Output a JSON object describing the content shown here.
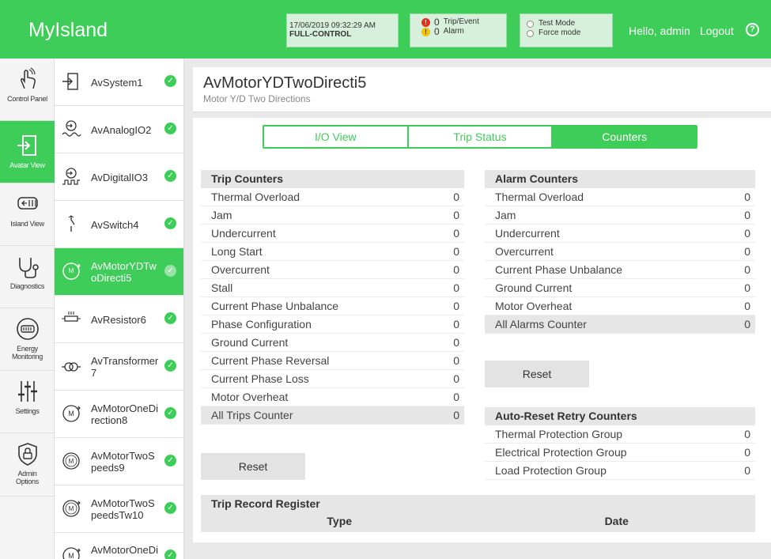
{
  "header": {
    "app_name": "MyIsland",
    "timestamp": "17/06/2019 09:32:29 AM",
    "control_mode": "FULL-CONTROL",
    "trip_count": "0",
    "trip_label": "Trip/Event",
    "alarm_count": "0",
    "alarm_label": "Alarm",
    "test_mode_label": "Test Mode",
    "force_mode_label": "Force mode",
    "greeting": "Hello, admin",
    "logout_label": "Logout",
    "help_glyph": "?",
    "accent_color": "#3dcd58"
  },
  "nav": {
    "control_panel": "Control Panel",
    "avatar_view": "Avatar View",
    "island_view": "Island View",
    "diagnostics": "Diagnostics",
    "energy_line1": "Energy",
    "energy_line2": "Monitoring",
    "settings": "Settings",
    "admin_line1": "Admin",
    "admin_line2": "Options"
  },
  "devices": [
    {
      "name": "AvSystem1",
      "icon": "system-icon"
    },
    {
      "name": "AvAnalogIO2",
      "icon": "analog-io-icon"
    },
    {
      "name": "AvDigitalIO3",
      "icon": "digital-io-icon"
    },
    {
      "name": "AvSwitch4",
      "icon": "switch-icon"
    },
    {
      "name": "AvMotorYDTwoDirecti5",
      "icon": "motor-icon"
    },
    {
      "name": "AvResistor6",
      "icon": "resistor-icon"
    },
    {
      "name": "AvTransformer7",
      "icon": "transformer-icon"
    },
    {
      "name": "AvMotorOneDirection8",
      "icon": "motor-icon"
    },
    {
      "name": "AvMotorTwoSpeeds9",
      "icon": "motor-icon"
    },
    {
      "name": "AvMotorTwoSpeedsTw10",
      "icon": "motor-icon"
    },
    {
      "name": "AvMotorOneDi",
      "icon": "motor-icon"
    }
  ],
  "device_labels": [
    "AvSystem1",
    "AvAnalogIO2",
    "AvDigitalIO3",
    "AvSwitch4",
    "AvMotorYDTw\noDirecti5",
    "AvResistor6",
    "AvTransformer\n7",
    "AvMotorOneDi\nrection8",
    "AvMotorTwoS\npeeds9",
    "AvMotorTwoS\npeedsTw10",
    "AvMotorOneDi"
  ],
  "main": {
    "device_title": "AvMotorYDTwoDirecti5",
    "device_subtitle": "Motor Y/D Two Directions",
    "tabs": [
      "I/O View",
      "Trip Status",
      "Counters"
    ],
    "active_tab": "Counters"
  },
  "trip_counters": {
    "title": "Trip Counters",
    "rows": [
      {
        "label": "Thermal Overload",
        "value": "0"
      },
      {
        "label": "Jam",
        "value": "0"
      },
      {
        "label": "Undercurrent",
        "value": "0"
      },
      {
        "label": "Long Start",
        "value": "0"
      },
      {
        "label": "Overcurrent",
        "value": "0"
      },
      {
        "label": "Stall",
        "value": "0"
      },
      {
        "label": "Current Phase Unbalance",
        "value": "0"
      },
      {
        "label": "Phase Configuration",
        "value": "0"
      },
      {
        "label": "Ground Current",
        "value": "0"
      },
      {
        "label": "Current Phase Reversal",
        "value": "0"
      },
      {
        "label": "Current Phase Loss",
        "value": "0"
      },
      {
        "label": "Motor Overheat",
        "value": "0"
      }
    ],
    "total": {
      "label": "All Trips Counter",
      "value": "0"
    },
    "reset_label": "Reset"
  },
  "alarm_counters": {
    "title": "Alarm Counters",
    "rows": [
      {
        "label": "Thermal Overload",
        "value": "0"
      },
      {
        "label": "Jam",
        "value": "0"
      },
      {
        "label": "Undercurrent",
        "value": "0"
      },
      {
        "label": "Overcurrent",
        "value": "0"
      },
      {
        "label": "Current Phase Unbalance",
        "value": "0"
      },
      {
        "label": "Ground Current",
        "value": "0"
      },
      {
        "label": "Motor Overheat",
        "value": "0"
      }
    ],
    "total": {
      "label": "All Alarms Counter",
      "value": "0"
    },
    "reset_label": "Reset"
  },
  "auto_reset": {
    "title": "Auto-Reset Retry Counters",
    "rows": [
      {
        "label": "Thermal Protection Group",
        "value": "0"
      },
      {
        "label": "Electrical Protection Group",
        "value": "0"
      },
      {
        "label": "Load Protection Group",
        "value": "0"
      }
    ]
  },
  "trip_record": {
    "title": "Trip Record Register",
    "columns": [
      "Type",
      "Date"
    ]
  }
}
